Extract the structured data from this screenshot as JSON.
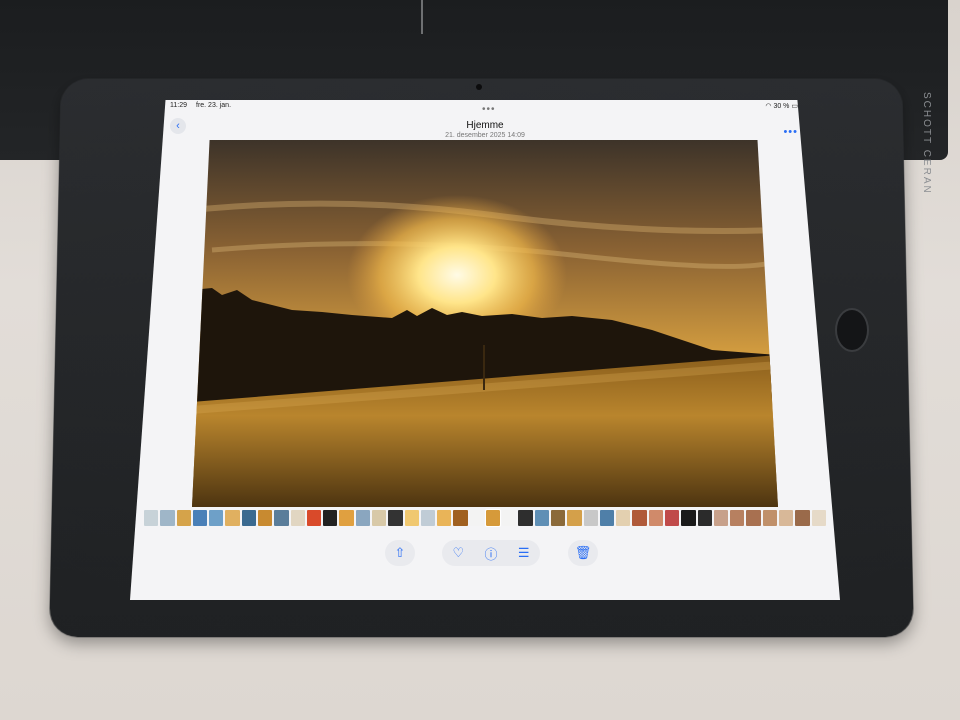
{
  "status_bar": {
    "time": "11:29",
    "date": "fre. 23. jan.",
    "battery": "30 %"
  },
  "header": {
    "title": "Hjemme",
    "subtitle": "21. desember 2025  14:09"
  },
  "mat": {
    "brand_text": "SCHOTT CERAN"
  },
  "toolbar": {
    "icons": [
      "share-icon",
      "heart-icon",
      "info-icon",
      "adjust-icon",
      "trash-icon"
    ]
  },
  "colors": {
    "accent": "#2a6ef5",
    "sky_top": "#4a3a2c",
    "sun": "#fff2b0",
    "field": "#a5731f"
  }
}
